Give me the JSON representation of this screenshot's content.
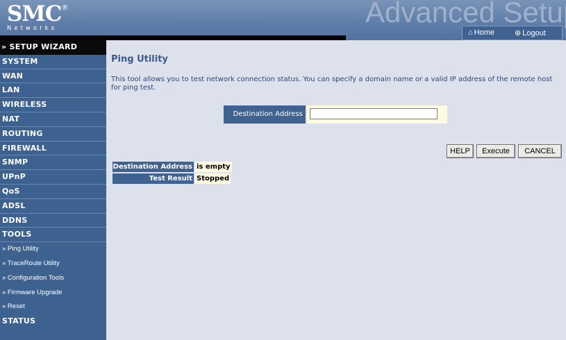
{
  "header": {
    "logo_text": "SMC",
    "logo_registered": "®",
    "logo_subtext": "Networks",
    "tagline": "Advanced Setup",
    "home_label": "Home",
    "logout_label": "Logout"
  },
  "sidebar": {
    "items": [
      {
        "label": "» SETUP WIZARD"
      },
      {
        "label": "SYSTEM"
      },
      {
        "label": "WAN"
      },
      {
        "label": "LAN"
      },
      {
        "label": "WIRELESS"
      },
      {
        "label": "NAT"
      },
      {
        "label": "ROUTING"
      },
      {
        "label": "FIREWALL"
      },
      {
        "label": "SNMP"
      },
      {
        "label": "UPnP"
      },
      {
        "label": "QoS"
      },
      {
        "label": "ADSL"
      },
      {
        "label": "DDNS"
      },
      {
        "label": "TOOLS"
      },
      {
        "label": "» Ping Utility"
      },
      {
        "label": "» TraceRoute Utility"
      },
      {
        "label": "» Configuration Tools"
      },
      {
        "label": "» Firmware Upgrade"
      },
      {
        "label": "» Reset"
      },
      {
        "label": "STATUS"
      }
    ]
  },
  "main": {
    "title": "Ping Utility",
    "description": "This tool allows you to test network connection status. You can specify a domain name or a valid IP address of the remote host for ping test.",
    "destination_label": "Destination Address",
    "destination_value": "",
    "buttons": {
      "help": "HELP",
      "execute": "Execute",
      "cancel": "CANCEL"
    },
    "results": [
      {
        "label": "Destination Address",
        "value": "is empty"
      },
      {
        "label": "Test Result",
        "value": "Stopped"
      }
    ]
  },
  "colors": {
    "sidebar_bg": "#3e6290",
    "content_bg": "#dde1ec",
    "title_color": "#3a5b89",
    "value_bg": "#fffbe0"
  }
}
